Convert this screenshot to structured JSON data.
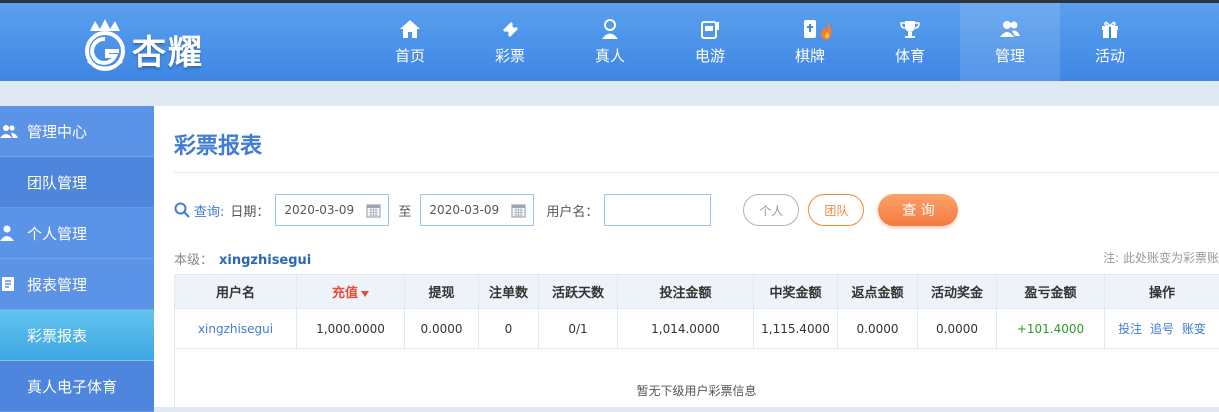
{
  "brand": {
    "name": "杏耀"
  },
  "nav": [
    {
      "label": "首页",
      "icon": "home-icon"
    },
    {
      "label": "彩票",
      "icon": "ticket-icon"
    },
    {
      "label": "真人",
      "icon": "dealer-icon"
    },
    {
      "label": "电游",
      "icon": "slot-machine-icon"
    },
    {
      "label": "棋牌",
      "icon": "mahjong-icon"
    },
    {
      "label": "体育",
      "icon": "trophy-icon"
    },
    {
      "label": "管理",
      "icon": "users-icon",
      "active": true
    },
    {
      "label": "活动",
      "icon": "gift-icon"
    }
  ],
  "sidebar": {
    "items": [
      {
        "label": "管理中心",
        "type": "header",
        "icon": "users-icon"
      },
      {
        "label": "团队管理",
        "type": "sub"
      },
      {
        "label": "个人管理",
        "type": "header",
        "icon": "user-icon"
      },
      {
        "label": "报表管理",
        "type": "header",
        "icon": "report-icon"
      },
      {
        "label": "彩票报表",
        "type": "sub",
        "active": true
      },
      {
        "label": "真人电子体育",
        "type": "sub"
      }
    ]
  },
  "page": {
    "title": "彩票报表"
  },
  "query": {
    "label": "查询:",
    "date_label": "日期：",
    "date_from": "2020-03-09",
    "to_label": "至",
    "date_to": "2020-03-09",
    "username_label": "用户名：",
    "username_value": "",
    "btn_personal": "个人",
    "btn_team": "团队",
    "btn_query": "查 询"
  },
  "level": {
    "label": "本级：",
    "name": "xingzhisegui"
  },
  "note": "注: 此处账变为彩票账",
  "table": {
    "headers": [
      "用户名",
      "充值",
      "提现",
      "注单数",
      "活跃天数",
      "投注金额",
      "中奖金额",
      "返点金额",
      "活动奖金",
      "盈亏金额",
      "操作"
    ],
    "rows": [
      {
        "username": "xingzhisegui",
        "recharge": "1,000.0000",
        "withdraw": "0.0000",
        "orders": "0",
        "active_days": "0/1",
        "bet_amount": "1,014.0000",
        "win_amount": "1,115.4000",
        "rebate": "0.0000",
        "bonus": "0.0000",
        "profit": "+101.4000",
        "actions": [
          "投注",
          "追号",
          "账变"
        ]
      }
    ],
    "empty_text": "暂无下级用户彩票信息"
  },
  "colors": {
    "accent": "#3f7cd6",
    "topbar": "#4a8fe8",
    "sidebar": "#5b93e6",
    "active_sub": "#3ea7e3",
    "orange": "#f47a3e",
    "profit": "#2a9a2a"
  }
}
